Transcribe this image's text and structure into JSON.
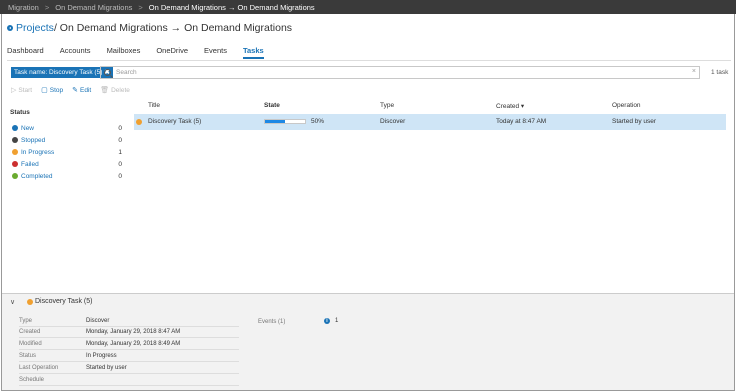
{
  "breadcrumb": {
    "items": [
      "Migration",
      "On Demand Migrations",
      "On Demand Migrations → On Demand Migrations"
    ]
  },
  "header": {
    "projects_link": "Projects",
    "title_rest": " / On Demand Migrations → On Demand Migrations"
  },
  "tabs": [
    {
      "label": "Dashboard",
      "active": false
    },
    {
      "label": "Accounts",
      "active": false
    },
    {
      "label": "Mailboxes",
      "active": false
    },
    {
      "label": "OneDrive",
      "active": false
    },
    {
      "label": "Events",
      "active": false
    },
    {
      "label": "Tasks",
      "active": true
    }
  ],
  "filter": {
    "chip_label": "Task name: Discovery Task (5)",
    "chip_close": "✖",
    "search_placeholder": "Search",
    "clear": "×",
    "count": "1 task"
  },
  "toolbar": {
    "start": "Start",
    "stop": "Stop",
    "edit": "Edit",
    "delete": "Delete"
  },
  "status_panel": {
    "title": "Status",
    "items": [
      {
        "label": "New",
        "count": "0"
      },
      {
        "label": "Stopped",
        "count": "0"
      },
      {
        "label": "In Progress",
        "count": "1"
      },
      {
        "label": "Failed",
        "count": "0"
      },
      {
        "label": "Completed",
        "count": "0"
      }
    ]
  },
  "grid": {
    "columns": {
      "title": "Title",
      "state": "State",
      "type": "Type",
      "created": "Created ▾",
      "operation": "Operation"
    },
    "rows": [
      {
        "title": "Discovery Task (5)",
        "progress": 0.5,
        "progress_label": "50%",
        "type": "Discover",
        "created": "Today at 8:47 AM",
        "operation": "Started by user"
      }
    ]
  },
  "details": {
    "chevron": "∨",
    "title": "Discovery Task (5)",
    "props": [
      {
        "key": "Type",
        "value": "Discover"
      },
      {
        "key": "Created",
        "value": "Monday, January 29, 2018 8:47 AM"
      },
      {
        "key": "Modified",
        "value": "Monday, January 29, 2018 8:49 AM"
      },
      {
        "key": "Status",
        "value": "In Progress"
      },
      {
        "key": "Last Operation",
        "value": "Started by user"
      },
      {
        "key": "Schedule",
        "value": ""
      }
    ],
    "events_label": "Events (1)",
    "events_value": "1"
  },
  "colors": {
    "accent": "#1a73b6",
    "selected_row": "#cfe5f6",
    "in_progress": "#f0a030"
  }
}
